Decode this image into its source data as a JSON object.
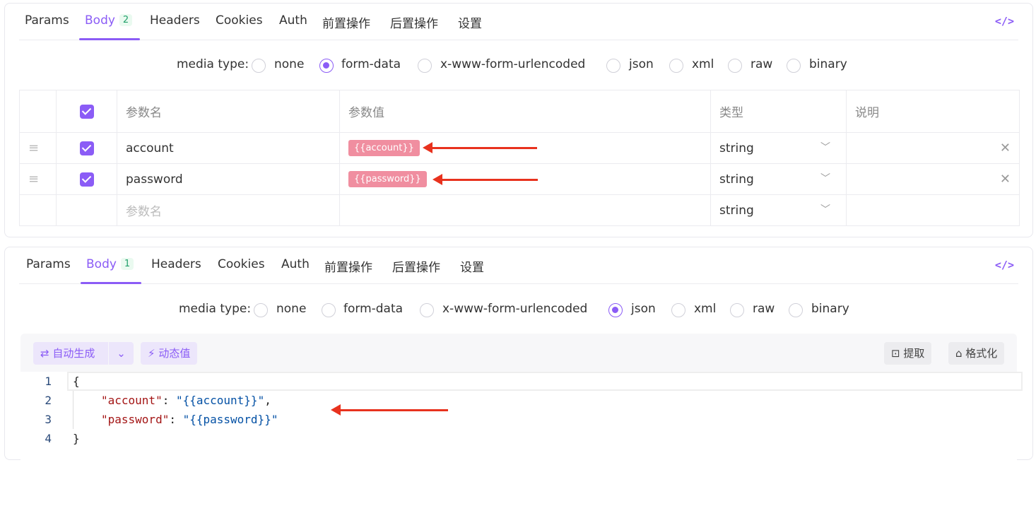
{
  "panel1": {
    "tabs": [
      {
        "label": "Params"
      },
      {
        "label": "Body",
        "badge": "2"
      },
      {
        "label": "Headers"
      },
      {
        "label": "Cookies"
      },
      {
        "label": "Auth"
      },
      {
        "label": "前置操作"
      },
      {
        "label": "后置操作"
      },
      {
        "label": "设置"
      }
    ],
    "code_icon": "</>",
    "media_label": "media type:",
    "media_options": [
      "none",
      "form-data",
      "x-www-form-urlencoded",
      "json",
      "xml",
      "raw",
      "binary"
    ],
    "media_selected": "form-data",
    "table": {
      "headers": {
        "name": "参数名",
        "value": "参数值",
        "type": "类型",
        "desc": "说明"
      },
      "rows": [
        {
          "name": "account",
          "value": "{{account}}",
          "type": "string"
        },
        {
          "name": "password",
          "value": "{{password}}",
          "type": "string"
        }
      ],
      "empty_row": {
        "name_placeholder": "参数名",
        "type": "string"
      }
    }
  },
  "panel2": {
    "tabs": [
      {
        "label": "Params"
      },
      {
        "label": "Body",
        "badge": "1"
      },
      {
        "label": "Headers"
      },
      {
        "label": "Cookies"
      },
      {
        "label": "Auth"
      },
      {
        "label": "前置操作"
      },
      {
        "label": "后置操作"
      },
      {
        "label": "设置"
      }
    ],
    "code_icon": "</>",
    "media_label": "media type:",
    "media_options": [
      "none",
      "form-data",
      "x-www-form-urlencoded",
      "json",
      "xml",
      "raw",
      "binary"
    ],
    "media_selected": "json",
    "toolbar": {
      "auto_generate": "自动生成",
      "dynamic_value": "动态值",
      "extract": "提取",
      "format": "格式化"
    },
    "code_lines": [
      {
        "no": "1",
        "text": "{"
      },
      {
        "no": "2",
        "key": "\"account\"",
        "value": "\"{{account}}\"",
        "suffix": ","
      },
      {
        "no": "3",
        "key": "\"password\"",
        "value": "\"{{password}}\"",
        "suffix": ""
      },
      {
        "no": "4",
        "text": "}"
      }
    ]
  },
  "colors": {
    "accent": "#8b5cf6",
    "tag": "#f08ea0",
    "arrow": "#e8321e"
  }
}
